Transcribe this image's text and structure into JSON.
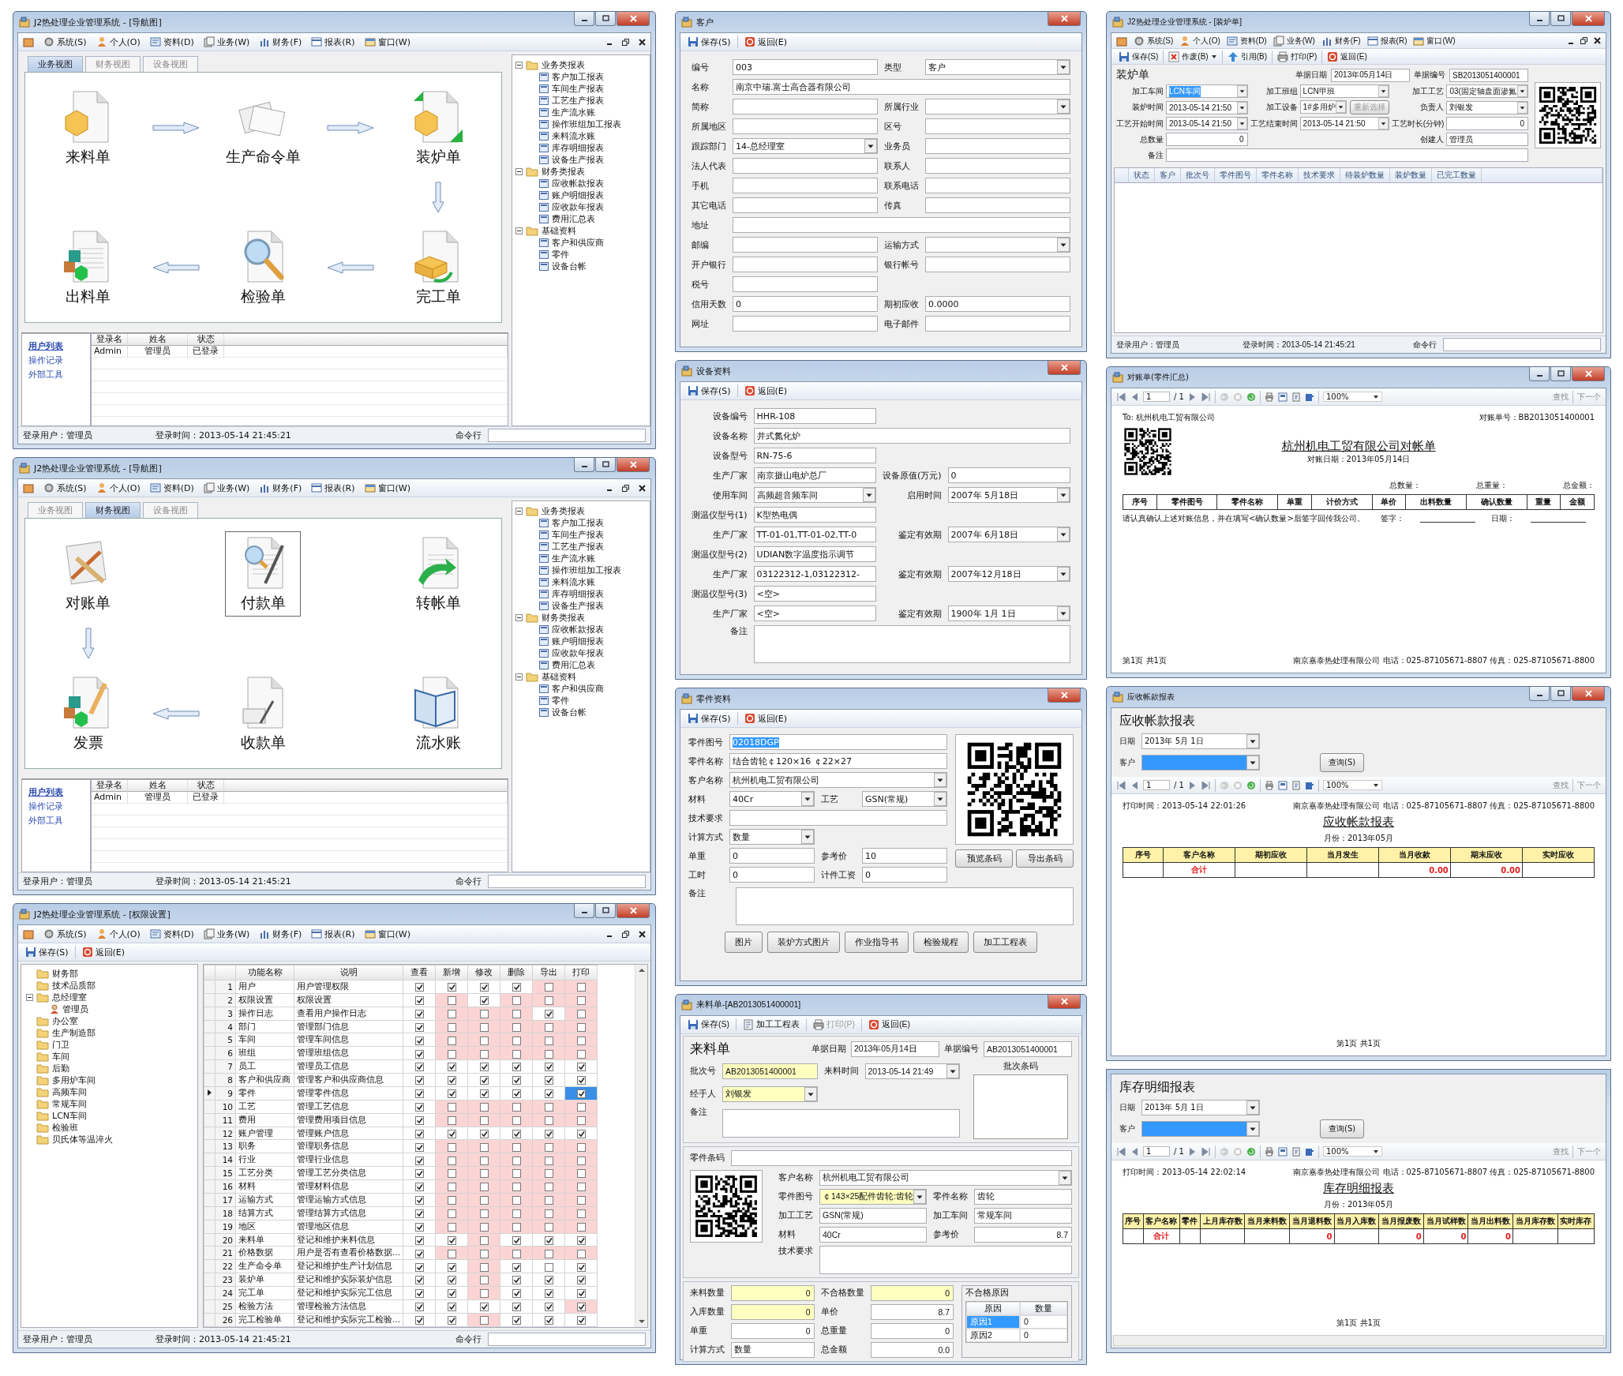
{
  "nav_windows": [
    {
      "title": "J2热处理企业管理系统 - [导航图]",
      "menu": [
        "系统(S)",
        "个人(O)",
        "资料(D)",
        "业务(W)",
        "财务(F)",
        "报表(R)",
        "窗口(W)"
      ],
      "tabs": [
        {
          "label": "业务视图",
          "selected": true
        },
        {
          "label": "财务视图",
          "selected": false
        },
        {
          "label": "设备视图",
          "selected": false
        }
      ],
      "nodes": [
        {
          "label": "来料单",
          "selected": false
        },
        {
          "label": "生产命令单",
          "selected": false
        },
        {
          "label": "装炉单",
          "selected": false
        },
        {
          "label": "出料单",
          "selected": false
        },
        {
          "label": "检验单",
          "selected": false
        },
        {
          "label": "完工单",
          "selected": false
        }
      ],
      "tree": [
        {
          "label": "业务类报表",
          "expanded": true,
          "children": [
            {
              "label": "客户加工报表"
            },
            {
              "label": "车间生产报表"
            },
            {
              "label": "工艺生产报表"
            },
            {
              "label": "生产流水账"
            },
            {
              "label": "操作班组加工报表"
            },
            {
              "label": "来料流水账"
            },
            {
              "label": "库存明细报表"
            },
            {
              "label": "设备生产报表"
            }
          ]
        },
        {
          "label": "财务类报表",
          "expanded": true,
          "children": [
            {
              "label": "应收帐款报表"
            },
            {
              "label": "账户明细报表"
            },
            {
              "label": "应收款年报表"
            },
            {
              "label": "费用汇总表"
            }
          ]
        },
        {
          "label": "基础资料",
          "expanded": true,
          "children": [
            {
              "label": "客户和供应商"
            },
            {
              "label": "零件"
            },
            {
              "label": "设备台帐"
            }
          ]
        }
      ],
      "links": [
        {
          "label": "用户列表",
          "selected": true
        },
        {
          "label": "操作记录",
          "selected": false
        },
        {
          "label": "外部工具",
          "selected": false
        }
      ],
      "users": {
        "columns": [
          "登录名",
          "姓名",
          "状态"
        ],
        "rows": [
          [
            "Admin",
            "管理员",
            "已登录"
          ]
        ]
      },
      "status": {
        "user": "登录用户：管理员",
        "time": "登录时间：2013-05-14 21:45:21",
        "command": "命令行"
      }
    },
    {
      "title": "J2热处理企业管理系统 - [导航图]",
      "menu": [
        "系统(S)",
        "个人(O)",
        "资料(D)",
        "业务(W)",
        "财务(F)",
        "报表(R)",
        "窗口(W)"
      ],
      "tabs": [
        {
          "label": "业务视图",
          "selected": false
        },
        {
          "label": "财务视图",
          "selected": true
        },
        {
          "label": "设备视图",
          "selected": false
        }
      ],
      "nodes": [
        {
          "label": "对账单",
          "selected": false
        },
        {
          "label": "付款单",
          "selected": true
        },
        {
          "label": "转帐单",
          "selected": false
        },
        {
          "label": "发票",
          "selected": false
        },
        {
          "label": "收款单",
          "selected": false
        },
        {
          "label": "流水账",
          "selected": false
        }
      ],
      "tree": [
        {
          "label": "业务类报表",
          "expanded": true,
          "children": [
            {
              "label": "客户加工报表"
            },
            {
              "label": "车间生产报表"
            },
            {
              "label": "工艺生产报表"
            },
            {
              "label": "生产流水账"
            },
            {
              "label": "操作班组加工报表"
            },
            {
              "label": "来料流水账"
            },
            {
              "label": "库存明细报表"
            },
            {
              "label": "设备生产报表"
            }
          ]
        },
        {
          "label": "财务类报表",
          "expanded": true,
          "children": [
            {
              "label": "应收帐款报表"
            },
            {
              "label": "账户明细报表"
            },
            {
              "label": "应收款年报表"
            },
            {
              "label": "费用汇总表"
            }
          ]
        },
        {
          "label": "基础资料",
          "expanded": true,
          "children": [
            {
              "label": "客户和供应商"
            },
            {
              "label": "零件"
            },
            {
              "label": "设备台帐"
            }
          ]
        }
      ],
      "links": [
        {
          "label": "用户列表",
          "selected": true
        },
        {
          "label": "操作记录",
          "selected": false
        },
        {
          "label": "外部工具",
          "selected": false
        }
      ],
      "users": {
        "columns": [
          "登录名",
          "姓名",
          "状态"
        ],
        "rows": [
          [
            "Admin",
            "管理员",
            "已登录"
          ]
        ]
      },
      "status": {
        "user": "登录用户：管理员",
        "time": "登录时间：2013-05-14 21:45:21",
        "command": "命令行"
      }
    }
  ],
  "perm_window": {
    "title": "J2热处理企业管理系统 - [权限设置]",
    "menu": [
      "系统(S)",
      "个人(O)",
      "资料(D)",
      "业务(W)",
      "财务(F)",
      "报表(R)",
      "窗口(W)"
    ],
    "toolbar": [
      {
        "label": "保存(S)"
      },
      {
        "label": "返回(E)"
      }
    ],
    "tree": [
      {
        "label": "财务部"
      },
      {
        "label": "技术品质部"
      },
      {
        "label": "总经理室",
        "expanded": true,
        "children": [
          {
            "label": "管理员"
          }
        ]
      },
      {
        "label": "办公室"
      },
      {
        "label": "生产制造部"
      },
      {
        "label": "门卫"
      },
      {
        "label": "车间"
      },
      {
        "label": "后勤"
      },
      {
        "label": "多用炉车间"
      },
      {
        "label": "高频车间"
      },
      {
        "label": "常规车间"
      },
      {
        "label": "LCN车间"
      },
      {
        "label": "检验班"
      },
      {
        "label": "贝氏体等温淬火"
      }
    ],
    "columns": [
      "功能名称",
      "说明",
      "查看",
      "新增",
      "修改",
      "删除",
      "导出",
      "打印"
    ],
    "rows": [
      {
        "num": "1",
        "name": "用户",
        "desc": "用户管理权限",
        "selected": false,
        "checked": [
          true,
          true,
          true,
          true,
          false,
          false
        ],
        "flagged": [
          false,
          false,
          false,
          false,
          true,
          true
        ]
      },
      {
        "num": "2",
        "name": "权限设置",
        "desc": "权限设置",
        "selected": false,
        "checked": [
          true,
          false,
          true,
          false,
          false,
          false
        ],
        "flagged": [
          false,
          true,
          false,
          true,
          true,
          true
        ]
      },
      {
        "num": "3",
        "name": "操作日志",
        "desc": "查看用户操作日志",
        "selected": false,
        "checked": [
          true,
          false,
          false,
          false,
          true,
          false
        ],
        "flagged": [
          false,
          true,
          true,
          true,
          false,
          true
        ]
      },
      {
        "num": "4",
        "name": "部门",
        "desc": "管理部门信息",
        "selected": false,
        "checked": [
          true,
          false,
          false,
          false,
          false,
          false
        ],
        "flagged": [
          false,
          true,
          true,
          true,
          true,
          true
        ]
      },
      {
        "num": "5",
        "name": "车间",
        "desc": "管理车间信息",
        "selected": false,
        "checked": [
          true,
          false,
          false,
          false,
          false,
          false
        ],
        "flagged": [
          false,
          true,
          true,
          true,
          true,
          true
        ]
      },
      {
        "num": "6",
        "name": "班组",
        "desc": "管理班组信息",
        "selected": false,
        "checked": [
          true,
          false,
          false,
          false,
          false,
          false
        ],
        "flagged": [
          false,
          true,
          true,
          true,
          true,
          true
        ]
      },
      {
        "num": "7",
        "name": "员工",
        "desc": "管理员工信息",
        "selected": false,
        "checked": [
          true,
          true,
          true,
          true,
          true,
          true
        ],
        "flagged": [
          false,
          false,
          false,
          false,
          false,
          false
        ]
      },
      {
        "num": "8",
        "name": "客户和供应商",
        "desc": "管理客户和供应商信息",
        "selected": false,
        "checked": [
          true,
          true,
          true,
          true,
          true,
          true
        ],
        "flagged": [
          false,
          false,
          false,
          false,
          false,
          false
        ]
      },
      {
        "num": "9",
        "name": "零件",
        "desc": "管理零件信息",
        "selected": true,
        "checked": [
          true,
          true,
          true,
          true,
          true,
          true
        ],
        "flagged": [
          false,
          false,
          false,
          false,
          false,
          false
        ],
        "focused": [
          false,
          false,
          false,
          false,
          false,
          true
        ]
      },
      {
        "num": "10",
        "name": "工艺",
        "desc": "管理工艺信息",
        "selected": false,
        "checked": [
          true,
          false,
          false,
          false,
          false,
          false
        ],
        "flagged": [
          false,
          true,
          true,
          true,
          true,
          true
        ]
      },
      {
        "num": "11",
        "name": "费用",
        "desc": "管理费用项目信息",
        "selected": false,
        "checked": [
          true,
          false,
          false,
          false,
          false,
          false
        ],
        "flagged": [
          false,
          true,
          true,
          true,
          true,
          true
        ]
      },
      {
        "num": "12",
        "name": "账户管理",
        "desc": "管理账户信息",
        "selected": false,
        "checked": [
          true,
          true,
          true,
          true,
          true,
          true
        ],
        "flagged": [
          false,
          false,
          false,
          false,
          false,
          false
        ]
      },
      {
        "num": "13",
        "name": "职务",
        "desc": "管理职务信息",
        "selected": false,
        "checked": [
          true,
          false,
          false,
          false,
          false,
          false
        ],
        "flagged": [
          false,
          true,
          true,
          true,
          true,
          true
        ]
      },
      {
        "num": "14",
        "name": "行业",
        "desc": "管理行业信息",
        "selected": false,
        "checked": [
          true,
          false,
          false,
          false,
          false,
          false
        ],
        "flagged": [
          false,
          true,
          true,
          true,
          true,
          true
        ]
      },
      {
        "num": "15",
        "name": "工艺分类",
        "desc": "管理工艺分类信息",
        "selected": false,
        "checked": [
          true,
          false,
          false,
          false,
          false,
          false
        ],
        "flagged": [
          false,
          true,
          true,
          true,
          true,
          true
        ]
      },
      {
        "num": "16",
        "name": "材料",
        "desc": "管理材料信息",
        "selected": false,
        "checked": [
          true,
          false,
          false,
          false,
          false,
          false
        ],
        "flagged": [
          false,
          true,
          true,
          true,
          true,
          true
        ]
      },
      {
        "num": "17",
        "name": "运输方式",
        "desc": "管理运输方式信息",
        "selected": false,
        "checked": [
          true,
          false,
          false,
          false,
          false,
          false
        ],
        "flagged": [
          false,
          true,
          true,
          true,
          true,
          true
        ]
      },
      {
        "num": "18",
        "name": "结算方式",
        "desc": "管理结算方式信息",
        "selected": false,
        "checked": [
          true,
          false,
          false,
          false,
          false,
          false
        ],
        "flagged": [
          false,
          true,
          true,
          true,
          true,
          true
        ]
      },
      {
        "num": "19",
        "name": "地区",
        "desc": "管理地区信息",
        "selected": false,
        "checked": [
          true,
          false,
          false,
          false,
          false,
          false
        ],
        "flagged": [
          false,
          true,
          true,
          true,
          true,
          true
        ]
      },
      {
        "num": "20",
        "name": "来料单",
        "desc": "登记和维护来料信息",
        "selected": false,
        "checked": [
          true,
          true,
          false,
          true,
          true,
          true
        ],
        "flagged": [
          false,
          false,
          true,
          false,
          false,
          false
        ]
      },
      {
        "num": "21",
        "name": "价格数据",
        "desc": "用户是否有查看价格数据...",
        "selected": false,
        "checked": [
          true,
          false,
          false,
          false,
          false,
          false
        ],
        "flagged": [
          false,
          true,
          true,
          true,
          true,
          true
        ]
      },
      {
        "num": "22",
        "name": "生产命令单",
        "desc": "登记和维护生产计划信息",
        "selected": false,
        "checked": [
          true,
          true,
          false,
          true,
          false,
          true
        ],
        "flagged": [
          false,
          false,
          true,
          false,
          false,
          false
        ]
      },
      {
        "num": "23",
        "name": "装炉单",
        "desc": "登记和维护实际装炉信息",
        "selected": false,
        "checked": [
          true,
          true,
          false,
          true,
          true,
          true
        ],
        "flagged": [
          false,
          false,
          true,
          false,
          false,
          false
        ]
      },
      {
        "num": "24",
        "name": "完工单",
        "desc": "登记和维护实际完工信息",
        "selected": false,
        "checked": [
          true,
          true,
          false,
          true,
          true,
          true
        ],
        "flagged": [
          false,
          false,
          true,
          false,
          false,
          false
        ]
      },
      {
        "num": "25",
        "name": "检验方法",
        "desc": "管理检验方法信息",
        "selected": false,
        "checked": [
          true,
          true,
          true,
          true,
          true,
          true
        ],
        "flagged": [
          false,
          false,
          false,
          false,
          false,
          true
        ]
      },
      {
        "num": "26",
        "name": "完工检验单",
        "desc": "登记和维护实际完工检验...",
        "selected": false,
        "checked": [
          true,
          true,
          false,
          true,
          true,
          true
        ],
        "flagged": [
          false,
          false,
          true,
          false,
          false,
          false
        ]
      }
    ],
    "status": {
      "user": "登录用户：管理员",
      "time": "登录时间：2013-05-14 21:45:21",
      "command": "命令行"
    }
  },
  "customer_window": {
    "title": "客户",
    "toolbar": [
      {
        "label": "保存(S)"
      },
      {
        "label": "返回(E)"
      }
    ],
    "rows": [
      [
        {
          "label": "编号",
          "value": "003",
          "kind": "text"
        },
        {
          "label": "类型",
          "value": "客户",
          "kind": "combo"
        }
      ],
      [
        {
          "label": "名称",
          "value": "南京中瑞.富士高合器有限公司",
          "kind": "text",
          "wide": true
        }
      ],
      [
        {
          "label": "简称",
          "kind": "text"
        },
        {
          "label": "所属行业",
          "kind": "combo"
        }
      ],
      [
        {
          "label": "所属地区",
          "kind": "text"
        },
        {
          "label": "区号",
          "kind": "text"
        }
      ],
      [
        {
          "label": "跟踪部门",
          "value": "14-总经理室",
          "kind": "combo"
        },
        {
          "label": "业务员",
          "kind": "text"
        }
      ],
      [
        {
          "label": "法人代表",
          "kind": "text"
        },
        {
          "label": "联系人",
          "kind": "text"
        }
      ],
      [
        {
          "label": "手机",
          "kind": "text"
        },
        {
          "label": "联系电话",
          "kind": "text"
        }
      ],
      [
        {
          "label": "其它电话",
          "kind": "text"
        },
        {
          "label": "传真",
          "kind": "text"
        }
      ],
      [
        {
          "label": "地址",
          "kind": "text",
          "wide": true
        }
      ],
      [
        {
          "label": "邮编",
          "kind": "text"
        },
        {
          "label": "运输方式",
          "kind": "combo"
        }
      ],
      [
        {
          "label": "开户银行",
          "kind": "text"
        },
        {
          "label": "银行帐号",
          "kind": "text"
        }
      ],
      [
        {
          "label": "税号",
          "kind": "text"
        }
      ],
      [
        {
          "label": "信用天数",
          "value": "0",
          "kind": "text"
        },
        {
          "label": "期初应收",
          "value": "0.0000",
          "kind": "text"
        }
      ],
      [
        {
          "label": "网址",
          "kind": "text"
        },
        {
          "label": "电子邮件",
          "kind": "text"
        }
      ]
    ]
  },
  "equipment_window": {
    "title": "设备资料",
    "toolbar": [
      {
        "label": "保存(S)"
      },
      {
        "label": "返回(E)"
      }
    ],
    "rows": [
      [
        {
          "label": "设备编号",
          "value": "HHR-108",
          "kind": "text"
        }
      ],
      [
        {
          "label": "设备名称",
          "value": "井式氮化炉",
          "kind": "text",
          "wide": true
        }
      ],
      [
        {
          "label": "设备型号",
          "value": "RN-75-6",
          "kind": "text"
        }
      ],
      [
        {
          "label": "生产厂家",
          "value": "南京摄山电炉总厂",
          "kind": "text"
        },
        {
          "label": "设备原值(万元)",
          "value": "0",
          "kind": "text"
        }
      ],
      [
        {
          "label": "使用车间",
          "value": "高频超音频车间",
          "kind": "combo"
        },
        {
          "label": "启用时间",
          "value": "2007年 5月18日",
          "kind": "combo"
        }
      ],
      [
        {
          "label": "测温仪型号(1)",
          "value": "K型热电偶",
          "kind": "text"
        }
      ],
      [
        {
          "label": "生产厂家",
          "value": "TT-01-01,TT-01-02,TT-0",
          "kind": "text"
        },
        {
          "label": "鉴定有效期",
          "value": "2007年 6月18日",
          "kind": "combo"
        }
      ],
      [
        {
          "label": "测温仪型号(2)",
          "value": "UDIAN数字温度指示调节",
          "kind": "text"
        }
      ],
      [
        {
          "label": "生产厂家",
          "value": "03122312-1,03122312-",
          "kind": "text"
        },
        {
          "label": "鉴定有效期",
          "value": "2007年12月18日",
          "kind": "combo"
        }
      ],
      [
        {
          "label": "测温仪型号(3)",
          "value": "<空>",
          "kind": "text"
        }
      ],
      [
        {
          "label": "生产厂家",
          "value": "<空>",
          "kind": "text"
        },
        {
          "label": "鉴定有效期",
          "value": "1900年 1月 1日",
          "kind": "combo"
        }
      ],
      [
        {
          "label": "备注",
          "kind": "memo",
          "wide": true
        }
      ]
    ]
  },
  "part_window": {
    "title": "零件资料",
    "toolbar": [
      {
        "label": "保存(S)"
      },
      {
        "label": "返回(E)"
      }
    ],
    "rows": [
      [
        {
          "label": "零件图号",
          "value": "02018DGP",
          "kind": "text",
          "wide": true,
          "text_selected": true
        }
      ],
      [
        {
          "label": "零件名称",
          "value": "结合齿轮￠120×16 ￠22×27",
          "kind": "text",
          "wide": true
        }
      ],
      [
        {
          "label": "客户名称",
          "value": "杭州机电工贸有限公司",
          "kind": "combo",
          "wide": true
        }
      ],
      [
        {
          "label": "材料",
          "value": "40Cr",
          "kind": "combo"
        },
        {
          "label": "工艺",
          "value": "GSN(常规)",
          "kind": "combo"
        }
      ],
      [
        {
          "label": "技术要求",
          "kind": "text",
          "wide": true
        }
      ],
      [
        {
          "label": "计算方式",
          "value": "数量",
          "kind": "combo"
        }
      ],
      [
        {
          "label": "单重",
          "value": "0",
          "kind": "text"
        },
        {
          "label": "参考价",
          "value": "10",
          "kind": "text"
        }
      ],
      [
        {
          "label": "工时",
          "value": "0",
          "kind": "text"
        },
        {
          "label": "计件工资",
          "value": "0",
          "kind": "text"
        }
      ]
    ],
    "memo": {
      "label": "备注",
      "kind": "memo"
    },
    "qr_buttons": [
      "预览条码",
      "导出条码"
    ],
    "buttons": [
      "图片",
      "装炉方式图片",
      "作业指导书",
      "检验规程",
      "加工工程表"
    ]
  },
  "incoming_window": {
    "title": "来料单-[AB2013051400001]",
    "toolbar": [
      {
        "label": "保存(S)",
        "disabled": false
      },
      {
        "label": "加工工程表",
        "disabled": false
      },
      {
        "label": "打印(P)",
        "disabled": true
      },
      {
        "label": "返回(E)",
        "disabled": false
      }
    ],
    "heading": "来料单",
    "doc_fields": [
      {
        "label": "单据日期",
        "value": "2013年05月14日",
        "kind": "text"
      },
      {
        "label": "单据编号",
        "value": "AB2013051400001",
        "kind": "text"
      }
    ],
    "batch_rows": [
      [
        {
          "label": "批次号",
          "value": "AB2013051400001",
          "kind": "text",
          "required": true
        },
        {
          "label": "来料时间",
          "value": "2013-05-14 21:49",
          "kind": "combo",
          "required": false
        }
      ],
      [
        {
          "label": "经手人",
          "value": "刘银发",
          "kind": "combo",
          "required": true
        }
      ],
      [
        {
          "label": "备注",
          "kind": "memo",
          "wide": true
        }
      ]
    ],
    "barcode_label": "批次条码",
    "part_code": {
      "label": "零件条码",
      "kind": "text"
    },
    "part_rows": [
      [
        {
          "label": "客户名称",
          "value": "杭州机电工贸有限公司",
          "kind": "combo",
          "wide": true,
          "required": false
        }
      ],
      [
        {
          "label": "零件图号",
          "value": "￠143×25配件齿轮:齿轮",
          "kind": "combo",
          "required": true
        },
        {
          "label": "零件名称",
          "value": "齿轮",
          "kind": "text",
          "required": false
        }
      ],
      [
        {
          "label": "加工工艺",
          "value": "GSN(常规)",
          "kind": "text"
        },
        {
          "label": "加工车间",
          "value": "常规车间",
          "kind": "text"
        }
      ],
      [
        {
          "label": "材料",
          "value": "40Cr",
          "kind": "text"
        },
        {
          "label": "参考价",
          "value": "8.7",
          "kind": "number"
        }
      ],
      [
        {
          "label": "技术要求",
          "kind": "memo",
          "wide": true
        }
      ]
    ],
    "qty_rows": [
      [
        {
          "label": "来料数量",
          "value": "0",
          "kind": "number",
          "required": true
        },
        {
          "label": "不合格数量",
          "value": "0",
          "kind": "number",
          "required": true
        }
      ],
      [
        {
          "label": "入库数量",
          "value": "0",
          "kind": "number",
          "required": true
        },
        {
          "label": "单价",
          "value": "8.7",
          "kind": "number",
          "required": false
        }
      ],
      [
        {
          "label": "单重",
          "value": "0",
          "kind": "number",
          "required": false
        },
        {
          "label": "总重量",
          "value": "0",
          "kind": "number",
          "required": false
        }
      ],
      [
        {
          "label": "计算方式",
          "value": "数量",
          "kind": "text",
          "required": false
        },
        {
          "label": "总金额",
          "value": "0.0",
          "kind": "number",
          "required": false
        }
      ]
    ],
    "reject": {
      "title": "不合格原因",
      "columns": [
        "原因",
        "数量"
      ],
      "rows": [
        {
          "cells": [
            "原因1",
            "0"
          ],
          "selected": true
        },
        {
          "cells": [
            "原因2",
            "0"
          ],
          "selected": false
        }
      ]
    }
  },
  "furnace_window": {
    "title": "J2热处理企业管理系统 - [装炉单]",
    "menu": [
      "系统(S)",
      "个人(O)",
      "资料(D)",
      "业务(W)",
      "财务(F)",
      "报表(R)",
      "窗口(W)"
    ],
    "toolbar": [
      {
        "label": "保存(S)",
        "kind": "button"
      },
      {
        "label": "作废(B)",
        "kind": "dropdown"
      },
      {
        "label": "引用(B)",
        "kind": "button"
      },
      {
        "label": "打印(P)",
        "kind": "button"
      },
      {
        "label": "返回(E)",
        "kind": "button"
      }
    ],
    "heading": "装炉单",
    "doc_fields": [
      {
        "label": "单据日期",
        "value": "2013年05月14日",
        "kind": "text"
      },
      {
        "label": "单据编号",
        "value": "SB2013051400001",
        "kind": "text"
      }
    ],
    "form_rows": [
      [
        {
          "label": "加工车间",
          "value": "LCN车间",
          "kind": "combo",
          "text_selected": true
        },
        {
          "label": "加工班组",
          "value": "LCN甲班",
          "kind": "combo",
          "text_selected": false
        },
        {
          "label": "加工工艺",
          "value": "03(固定轴盘面渗氮",
          "kind": "combo",
          "text_selected": false
        }
      ],
      [
        {
          "label": "装炉时间",
          "value": "2013-05-14 21:50",
          "kind": "combo"
        },
        {
          "label": "加工设备",
          "value": "1#多用炉",
          "kind": "combo",
          "button": {
            "label": "重新选择",
            "disabled": true
          }
        },
        {
          "label": "负责人",
          "value": "刘银发",
          "kind": "combo"
        }
      ],
      [
        {
          "label": "工艺开始时间",
          "value": "2013-05-14 21:50",
          "kind": "combo"
        },
        {
          "label": "工艺结束时间",
          "value": "2013-05-14 21:50",
          "kind": "combo"
        },
        {
          "label": "工艺时长(分钟)",
          "value": "0",
          "kind": "number"
        }
      ],
      [
        {
          "label": "总数量",
          "value": "0",
          "kind": "number"
        },
        {
          "label": "创建人",
          "value": "管理员",
          "kind": "text"
        }
      ],
      [
        {
          "label": "备注",
          "kind": "text",
          "wide": true
        }
      ]
    ],
    "grid_columns": [
      "状态",
      "客户",
      "批次号",
      "零件图号",
      "零件名称",
      "技术要求",
      "待装炉数量",
      "装炉数量",
      "已完工数量"
    ],
    "status": {
      "user": "登录用户：管理员",
      "time": "登录时间：2013-05-14 21:45:21",
      "command": "命令行"
    }
  },
  "recon_window": {
    "title": "对账单(零件汇总)",
    "pager": {
      "page": "1",
      "total": "/ 1",
      "zoom": "100%",
      "find": "查找",
      "next": "下一个"
    },
    "doc": {
      "to": "To: 杭州机电工贸有限公司",
      "number": "对账单号：BB2013051400001",
      "heading": "杭州机电工贸有限公司对帐单",
      "date": "对账日期：2013年05月14日",
      "totals": [
        "总数量：",
        "总重量：",
        "总金额："
      ],
      "columns": [
        "序号",
        "零件图号",
        "零件名称",
        "单重",
        "计价方式",
        "单价",
        "出料数量",
        "确认数量",
        "重量",
        "金额"
      ],
      "note": "请认真确认上述对账信息，并在填写<确认数量>后签字回传我公司。",
      "sign": "签字：",
      "sign_date": "日期：",
      "page": "第1页  共1页",
      "company": "南京嘉泰热处理有限公司  电话：025-87105671-8807 传真：025-87105671-8800"
    }
  },
  "receivable_window": {
    "title": "应收帐款报表",
    "filters": {
      "heading": "应收帐款报表",
      "date_label": "日期",
      "date": "2013年 5月 1日",
      "customer_label": "客户",
      "customer_selected": true,
      "query": "查询(S)"
    },
    "pager": {
      "page": "1",
      "total": "/ 1",
      "zoom": "100%",
      "find": "查找",
      "next": "下一个"
    },
    "doc": {
      "printed": "打印时间：2013-05-14 22:01:26",
      "company": "南京嘉泰热处理有限公司  电话：025-87105671-8807 传真：025-87105671-8800",
      "heading": "应收帐款报表",
      "month": "月份：2013年05月",
      "columns": [
        "序号",
        "客户名称",
        "期初应收",
        "当月发生",
        "当月收款",
        "期末应收",
        "实时应收"
      ],
      "rows": [
        {
          "total": true,
          "cells": [
            null,
            "合计",
            null,
            null,
            "0.00",
            "0.00",
            null
          ]
        }
      ],
      "page": "第1页  共1页"
    }
  },
  "inventory_window": {
    "filters": {
      "heading": "库存明细报表",
      "date_label": "日期",
      "date": "2013年 5月 1日",
      "customer_label": "客户",
      "customer_selected": true,
      "query": "查询(S)"
    },
    "pager": {
      "page": "1",
      "total": "/ 1",
      "zoom": "100%",
      "find": "查找",
      "next": "下一个"
    },
    "doc": {
      "printed": "打印时间：2013-05-14 22:02:14",
      "company": "南京嘉泰热处理有限公司  电话：025-87105671-8807 传真：025-87105671-8800",
      "heading": "库存明细报表",
      "month": "月份：2013年05月",
      "columns": [
        "序号",
        "客户名称",
        "零件",
        "上月库存数",
        "当月来料数",
        "当月退料数",
        "当月入库数",
        "当月报废数",
        "当月试样数",
        "当月出料数",
        "当月库存数",
        "实时库存"
      ],
      "rows": [
        {
          "total": true,
          "cells": [
            null,
            "合计",
            null,
            null,
            null,
            "0",
            null,
            "0",
            "0",
            "0",
            null,
            null
          ]
        }
      ],
      "page": "第1页  共1页"
    }
  }
}
